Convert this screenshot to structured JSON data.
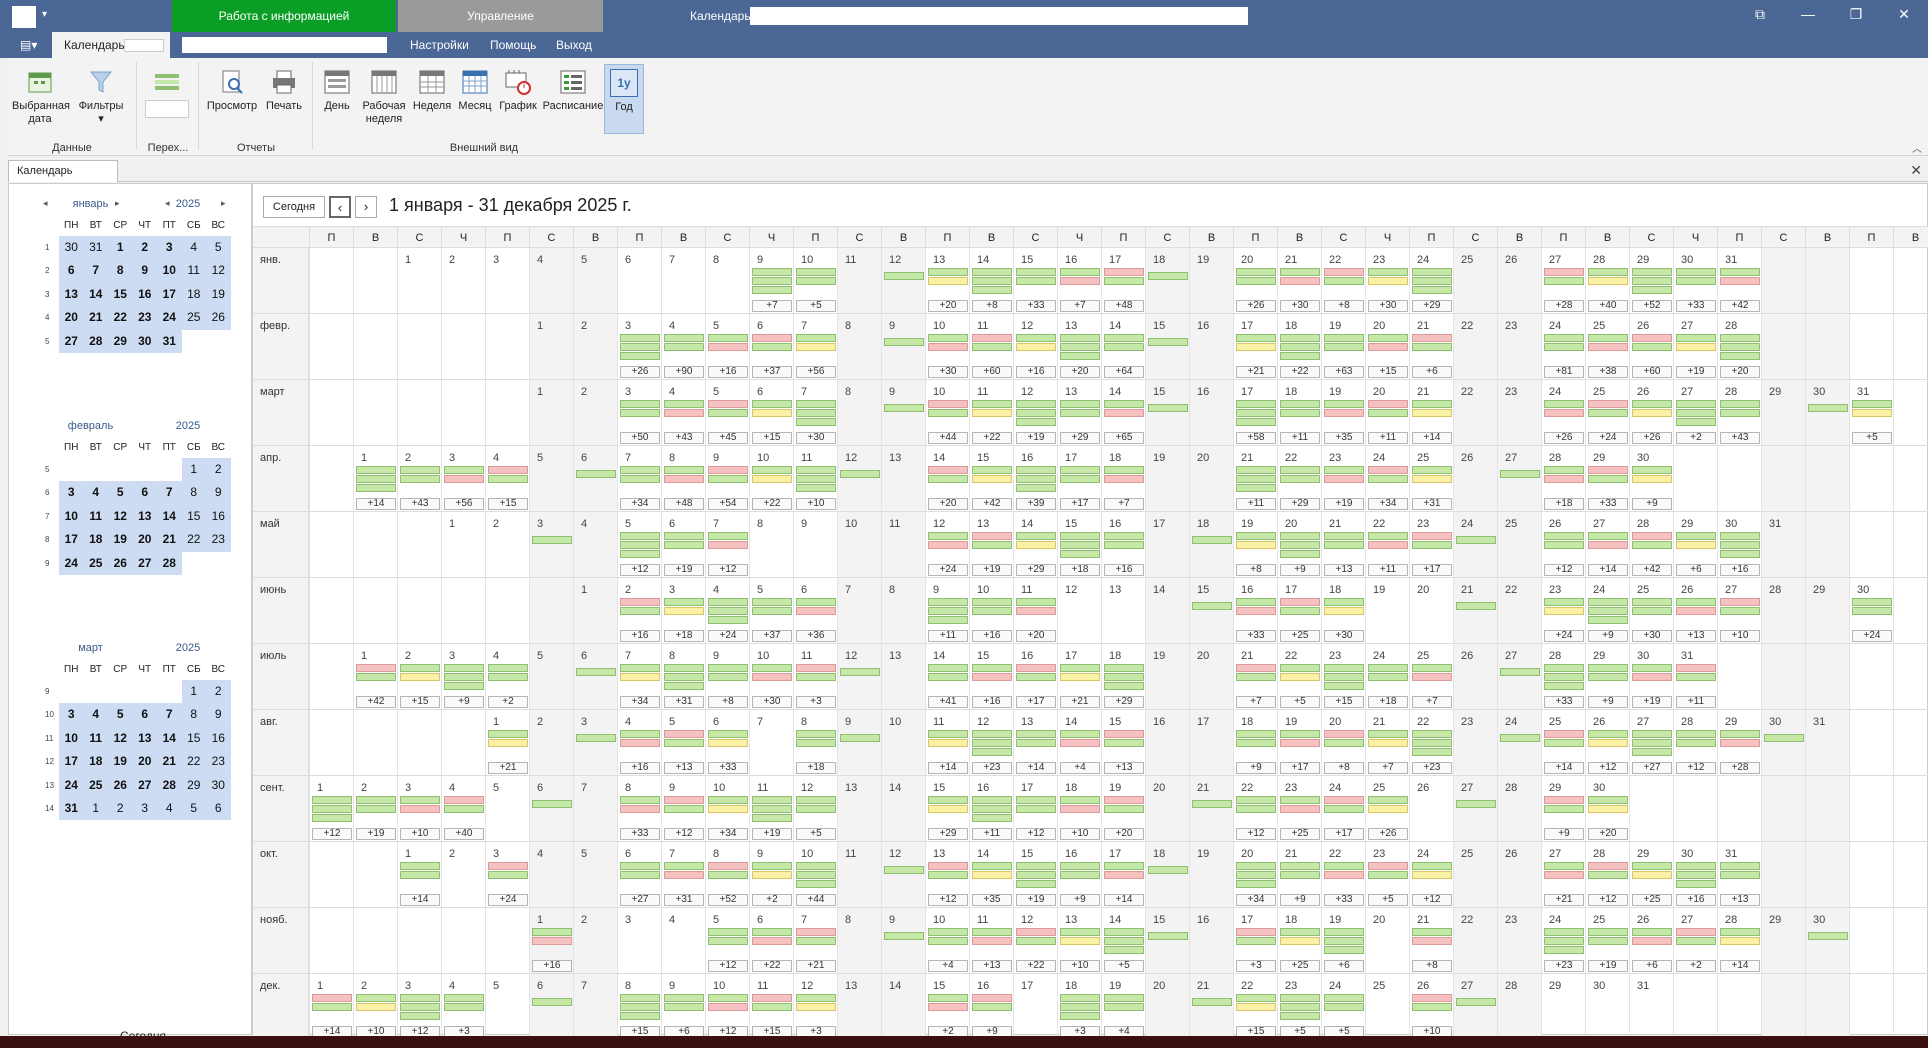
{
  "window": {
    "tab_info": "Работа с информацией",
    "tab_mgmt": "Управление",
    "calendar_label": "Календарь",
    "win_icons": [
      "maximize-icon",
      "minimize-icon",
      "restore-icon",
      "close-icon"
    ]
  },
  "menu": {
    "tab_calendar": "Календарь",
    "settings": "Настройки",
    "help": "Помощь",
    "exit": "Выход"
  },
  "ribbon": {
    "selected_date": "Выбранная дата",
    "filters": "Фильтры",
    "preview": "Просмотр",
    "print": "Печать",
    "day": "День",
    "work_week": "Рабочая неделя",
    "week": "Неделя",
    "month": "Месяц",
    "chart": "График",
    "schedule": "Расписание",
    "year": "Год",
    "year_icon": "1y",
    "group_data": "Данные",
    "group_jump": "Перех...",
    "group_reports": "Отчеты",
    "group_view": "Внешний вид"
  },
  "doc_tab": {
    "label": "Календарь"
  },
  "sidebar": {
    "today_label": "Сегодня",
    "dow": [
      "ПН",
      "ВТ",
      "СР",
      "ЧТ",
      "ПТ",
      "СБ",
      "ВС"
    ],
    "months": [
      {
        "name": "январь",
        "year": "2025",
        "weeks": [
          "1",
          "2",
          "3",
          "4",
          "5"
        ],
        "start": 1,
        "days": 31,
        "prev_tail": [
          30,
          31
        ],
        "show_arrows": true
      },
      {
        "name": "февраль",
        "year": "2025",
        "weeks": [
          "5",
          "6",
          "7",
          "8",
          "9"
        ],
        "start": 5,
        "days": 28,
        "prev_tail": [],
        "show_arrows": false
      },
      {
        "name": "март",
        "year": "2025",
        "weeks": [
          "9",
          "10",
          "11",
          "12",
          "13",
          "14"
        ],
        "start": 5,
        "days": 31,
        "prev_tail": [],
        "next_head": [
          1,
          2,
          3,
          4,
          5,
          6
        ],
        "show_arrows": false
      }
    ]
  },
  "main": {
    "today_btn": "Сегодня",
    "range_title": "1 января - 31 декабря 2025 г.",
    "dow_header": [
      "П",
      "В",
      "С",
      "Ч",
      "П",
      "С",
      "В",
      "П",
      "В",
      "С",
      "Ч",
      "П",
      "С",
      "В",
      "П",
      "В",
      "С",
      "Ч",
      "П",
      "С",
      "В",
      "П",
      "В",
      "С",
      "Ч",
      "П",
      "С",
      "В",
      "П",
      "В",
      "С",
      "Ч",
      "П",
      "С",
      "В",
      "П",
      "В",
      "С"
    ],
    "months": [
      {
        "label": "янв.",
        "start": 2,
        "days": 31,
        "more": {
          "9": "+7",
          "10": "+5",
          "13": "+20",
          "14": "+8",
          "15": "+33",
          "16": "+7",
          "17": "+48",
          "20": "+26",
          "21": "+30",
          "22": "+8",
          "23": "+30",
          "24": "+29",
          "27": "+28",
          "28": "+40",
          "29": "+52",
          "30": "+33",
          "31": "+42"
        }
      },
      {
        "label": "февр.",
        "start": 5,
        "days": 28,
        "more": {
          "3": "+26",
          "4": "+90",
          "5": "+16",
          "6": "+37",
          "7": "+56",
          "10": "+30",
          "11": "+60",
          "12": "+16",
          "13": "+20",
          "14": "+64",
          "17": "+21",
          "18": "+22",
          "19": "+63",
          "20": "+15",
          "21": "+6",
          "24": "+81",
          "25": "+38",
          "26": "+60",
          "27": "+19",
          "28": "+20"
        }
      },
      {
        "label": "март",
        "start": 5,
        "days": 31,
        "more": {
          "3": "+50",
          "4": "+43",
          "5": "+45",
          "6": "+15",
          "7": "+30",
          "10": "+44",
          "11": "+22",
          "12": "+19",
          "13": "+29",
          "14": "+65",
          "17": "+58",
          "18": "+11",
          "19": "+35",
          "20": "+11",
          "21": "+14",
          "24": "+26",
          "25": "+24",
          "26": "+26",
          "27": "+2",
          "28": "+43",
          "31": "+5"
        }
      },
      {
        "label": "апр.",
        "start": 1,
        "days": 30,
        "more": {
          "1": "+14",
          "2": "+43",
          "3": "+56",
          "4": "+15",
          "7": "+34",
          "8": "+48",
          "9": "+54",
          "10": "+22",
          "11": "+10",
          "14": "+20",
          "15": "+42",
          "16": "+39",
          "17": "+17",
          "18": "+7",
          "21": "+11",
          "22": "+29",
          "23": "+19",
          "24": "+34",
          "25": "+31",
          "28": "+18",
          "29": "+33",
          "30": "+9"
        }
      },
      {
        "label": "май",
        "start": 3,
        "days": 31,
        "more": {
          "5": "+12",
          "6": "+19",
          "7": "+12",
          "12": "+24",
          "13": "+19",
          "14": "+29",
          "15": "+18",
          "16": "+16",
          "19": "+8",
          "20": "+9",
          "21": "+13",
          "22": "+11",
          "23": "+17",
          "26": "+12",
          "27": "+14",
          "28": "+42",
          "29": "+6",
          "30": "+16"
        }
      },
      {
        "label": "июнь",
        "start": 6,
        "days": 30,
        "more": {
          "2": "+16",
          "3": "+18",
          "4": "+24",
          "5": "+37",
          "6": "+36",
          "9": "+11",
          "10": "+16",
          "11": "+20",
          "16": "+33",
          "17": "+25",
          "18": "+30",
          "23": "+24",
          "24": "+9",
          "25": "+30",
          "26": "+13",
          "27": "+10",
          "30": "+24"
        }
      },
      {
        "label": "июль",
        "start": 1,
        "days": 31,
        "more": {
          "1": "+42",
          "2": "+15",
          "3": "+9",
          "4": "+2",
          "7": "+34",
          "8": "+31",
          "9": "+8",
          "10": "+30",
          "11": "+3",
          "14": "+41",
          "15": "+16",
          "16": "+17",
          "17": "+21",
          "18": "+29",
          "21": "+7",
          "22": "+5",
          "23": "+15",
          "24": "+18",
          "25": "+7",
          "28": "+33",
          "29": "+9",
          "30": "+19",
          "31": "+11"
        }
      },
      {
        "label": "авг.",
        "start": 4,
        "days": 31,
        "more": {
          "1": "+21",
          "4": "+16",
          "5": "+13",
          "6": "+33",
          "8": "+18",
          "11": "+14",
          "12": "+23",
          "13": "+14",
          "14": "+4",
          "15": "+13",
          "18": "+9",
          "19": "+17",
          "20": "+8",
          "21": "+7",
          "22": "+23",
          "25": "+14",
          "26": "+12",
          "27": "+27",
          "28": "+12",
          "29": "+28"
        }
      },
      {
        "label": "сент.",
        "start": 0,
        "days": 30,
        "more": {
          "1": "+12",
          "2": "+19",
          "3": "+10",
          "4": "+40",
          "8": "+33",
          "9": "+12",
          "10": "+34",
          "11": "+19",
          "12": "+5",
          "15": "+29",
          "16": "+11",
          "17": "+12",
          "18": "+10",
          "19": "+20",
          "22": "+12",
          "23": "+25",
          "24": "+17",
          "25": "+26",
          "29": "+9",
          "30": "+20"
        }
      },
      {
        "label": "окт.",
        "start": 2,
        "days": 31,
        "more": {
          "1": "+14",
          "3": "+24",
          "6": "+27",
          "7": "+31",
          "8": "+52",
          "9": "+2",
          "10": "+44",
          "13": "+12",
          "14": "+35",
          "15": "+19",
          "16": "+9",
          "17": "+14",
          "20": "+34",
          "21": "+9",
          "22": "+33",
          "23": "+5",
          "24": "+12",
          "27": "+21",
          "28": "+12",
          "29": "+25",
          "30": "+16",
          "31": "+13"
        }
      },
      {
        "label": "нояб.",
        "start": 5,
        "days": 30,
        "more": {
          "1": "+16",
          "5": "+12",
          "6": "+22",
          "7": "+21",
          "10": "+4",
          "11": "+13",
          "12": "+22",
          "13": "+10",
          "14": "+5",
          "17": "+3",
          "18": "+25",
          "19": "+6",
          "21": "+8",
          "24": "+23",
          "25": "+19",
          "26": "+6",
          "27": "+2",
          "28": "+14"
        }
      },
      {
        "label": "дек.",
        "start": 0,
        "days": 31,
        "more": {
          "1": "+14",
          "2": "+10",
          "3": "+12",
          "4": "+3",
          "8": "+15",
          "9": "+6",
          "10": "+12",
          "11": "+15",
          "12": "+3",
          "15": "+2",
          "16": "+9",
          "18": "+3",
          "19": "+4",
          "22": "+15",
          "23": "+5",
          "24": "+5",
          "26": "+10"
        }
      }
    ],
    "colors": {
      "green": "#c5e8a8",
      "red": "#f6c1c1",
      "yellow": "#fbf1a6"
    }
  }
}
